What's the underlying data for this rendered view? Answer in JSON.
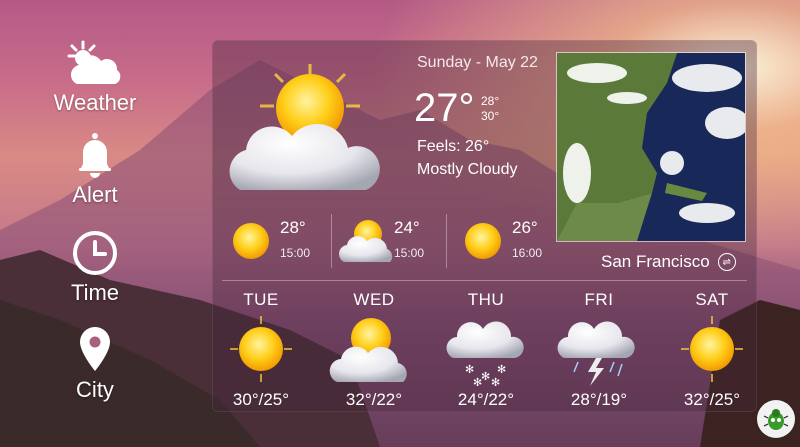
{
  "nav": [
    {
      "key": "weather",
      "label": "Weather",
      "icon": "weather-icon"
    },
    {
      "key": "alert",
      "label": "Alert",
      "icon": "bell-icon"
    },
    {
      "key": "time",
      "label": "Time",
      "icon": "clock-icon"
    },
    {
      "key": "city",
      "label": "City",
      "icon": "location-pin-icon"
    }
  ],
  "current": {
    "date": "Sunday - May 22",
    "temp": "27°",
    "high": "28°",
    "low": "30°",
    "feels": "Feels: 26°",
    "condition": "Mostly Cloudy",
    "icon": "sun-cloud-icon"
  },
  "city": "San Francisco",
  "hourly": [
    {
      "temp": "28°",
      "time": "15:00",
      "icon": "sun-icon"
    },
    {
      "temp": "24°",
      "time": "15:00",
      "icon": "sun-cloud-icon"
    },
    {
      "temp": "26°",
      "time": "16:00",
      "icon": "sun-icon"
    }
  ],
  "daily": [
    {
      "day": "TUE",
      "range": "30°/25°",
      "icon": "sun-icon"
    },
    {
      "day": "WED",
      "range": "32°/22°",
      "icon": "sun-cloud-icon"
    },
    {
      "day": "THU",
      "range": "24°/22°",
      "icon": "snow-cloud-icon"
    },
    {
      "day": "FRI",
      "range": "28°/19°",
      "icon": "thunderstorm-icon"
    },
    {
      "day": "SAT",
      "range": "32°/25°",
      "icon": "sun-icon"
    }
  ]
}
